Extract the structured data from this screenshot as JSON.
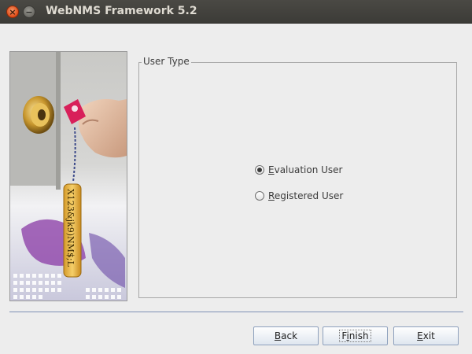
{
  "window": {
    "title": "WebNMS Framework 5.2",
    "close_glyph": "×",
    "minimize_glyph": "−"
  },
  "illustration": {
    "tag_text": "X123&jk9)NM$;L",
    "icon": "door-lock-key-illustration"
  },
  "user_type": {
    "group_label": "User Type",
    "options": [
      {
        "mnemonic": "E",
        "rest": "valuation User",
        "selected": true
      },
      {
        "mnemonic": "R",
        "rest": "egistered User",
        "selected": false
      }
    ]
  },
  "buttons": {
    "back": {
      "mnemonic": "B",
      "rest": "ack"
    },
    "finish": {
      "pre": "F",
      "mnemonic": "i",
      "rest": "nish"
    },
    "exit": {
      "mnemonic": "E",
      "rest": "xit"
    }
  },
  "colors": {
    "titlebar": "#3c3b37",
    "close_button": "#df4a16",
    "background": "#ededed",
    "separator": "#7e90b4",
    "key_tag": "#e6b84a",
    "fob": "#d8205a"
  }
}
